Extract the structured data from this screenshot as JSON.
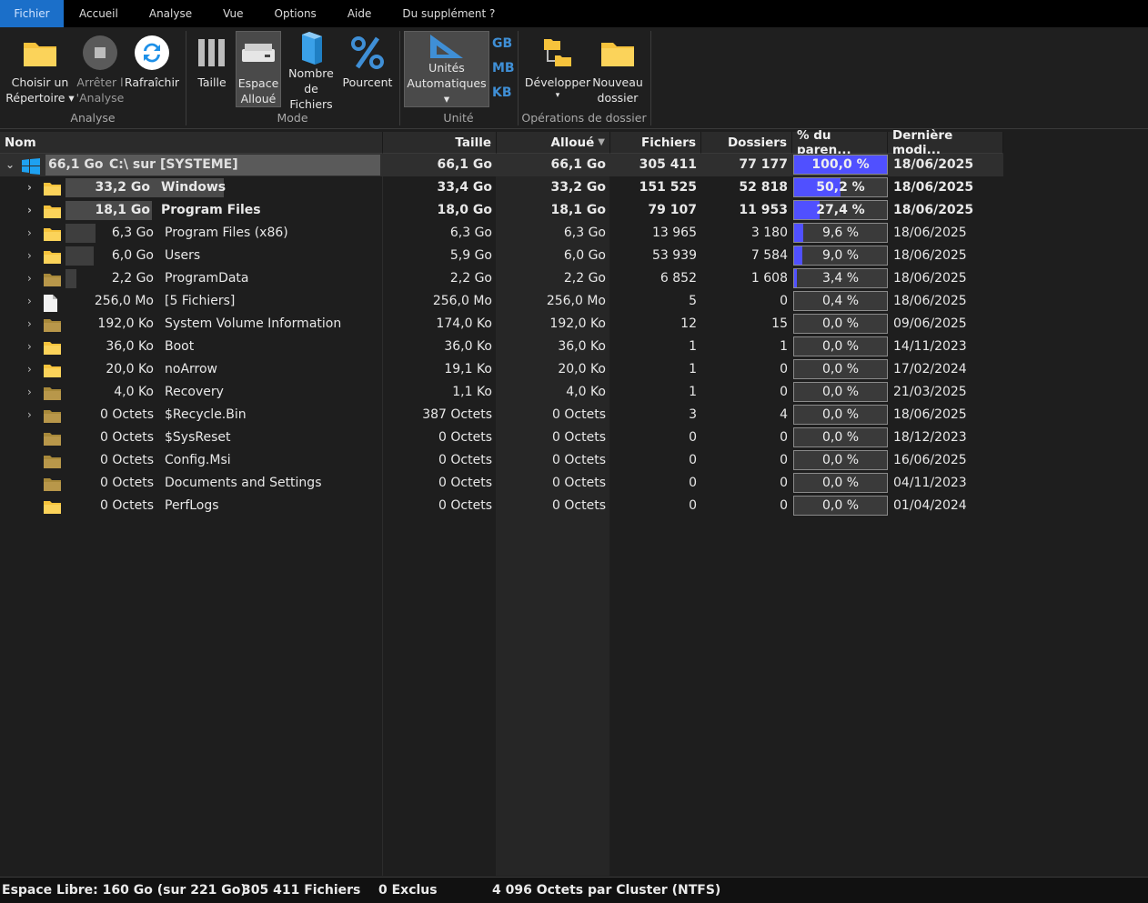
{
  "menu": [
    "Fichier",
    "Accueil",
    "Analyse",
    "Vue",
    "Options",
    "Aide",
    "Du supplément ?"
  ],
  "ribbon": {
    "choose_dir": [
      "Choisir un",
      "Répertoire ▾"
    ],
    "stop": [
      "Arrêter l",
      "'Analyse"
    ],
    "refresh": [
      "Rafraîchir"
    ],
    "size": [
      "Taille"
    ],
    "allocated": [
      "Espace",
      "Alloué"
    ],
    "file_count": [
      "Nombre",
      "de Fichiers"
    ],
    "percent": [
      "Pourcent"
    ],
    "units_auto": [
      "Unités",
      "Automatiques ▾"
    ],
    "unit_gb": "GB",
    "unit_mb": "MB",
    "unit_kb": "KB",
    "expand": [
      "Développer",
      "▾"
    ],
    "new_folder": [
      "Nouveau",
      "dossier"
    ],
    "groups": {
      "analyse": "Analyse",
      "mode": "Mode",
      "unit": "Unité",
      "folder_ops": "Opérations de dossier"
    }
  },
  "columns": {
    "name": "Nom",
    "size": "Taille",
    "allocated": "Alloué",
    "files": "Fichiers",
    "folders": "Dossiers",
    "pct": "% du paren...",
    "modified": "Dernière modi..."
  },
  "rows": [
    {
      "exp": "⌄",
      "icon": "windows",
      "alloc": "66,1 Go",
      "name": "C:\\  sur  [SYSTEME]",
      "size": "66,1 Go",
      "allocated": "66,1 Go",
      "files": "305 411",
      "folders": "77 177",
      "pct": 100.0,
      "pct_text": "100,0 %",
      "date": "18/06/2025",
      "bold": true,
      "root": true
    },
    {
      "exp": "›",
      "icon": "folder",
      "alloc": "33,2 Go",
      "name": "Windows",
      "size": "33,4 Go",
      "allocated": "33,2 Go",
      "files": "151 525",
      "folders": "52 818",
      "pct": 50.2,
      "pct_text": "50,2 %",
      "date": "18/06/2025",
      "bold": true,
      "bar": 0.5
    },
    {
      "exp": "›",
      "icon": "folder",
      "alloc": "18,1 Go",
      "name": "Program Files",
      "size": "18,0 Go",
      "allocated": "18,1 Go",
      "files": "79 107",
      "folders": "11 953",
      "pct": 27.4,
      "pct_text": "27,4 %",
      "date": "18/06/2025",
      "bold": true,
      "bar": 0.274
    },
    {
      "exp": "›",
      "icon": "folder",
      "alloc": "6,3 Go",
      "name": "Program Files (x86)",
      "size": "6,3 Go",
      "allocated": "6,3 Go",
      "files": "13 965",
      "folders": "3 180",
      "pct": 9.6,
      "pct_text": "9,6 %",
      "date": "18/06/2025",
      "bold": false,
      "bar": 0.096
    },
    {
      "exp": "›",
      "icon": "folder",
      "alloc": "6,0 Go",
      "name": "Users",
      "size": "5,9 Go",
      "allocated": "6,0 Go",
      "files": "53 939",
      "folders": "7 584",
      "pct": 9.0,
      "pct_text": "9,0 %",
      "date": "18/06/2025",
      "bold": false,
      "bar": 0.09
    },
    {
      "exp": "›",
      "icon": "folder-dim",
      "alloc": "2,2 Go",
      "name": "ProgramData",
      "size": "2,2 Go",
      "allocated": "2,2 Go",
      "files": "6 852",
      "folders": "1 608",
      "pct": 3.4,
      "pct_text": "3,4 %",
      "date": "18/06/2025",
      "bold": false,
      "bar": 0.034
    },
    {
      "exp": "›",
      "icon": "file",
      "alloc": "256,0 Mo",
      "name": "[5 Fichiers]",
      "size": "256,0 Mo",
      "allocated": "256,0 Mo",
      "files": "5",
      "folders": "0",
      "pct": 0.4,
      "pct_text": "0,4 %",
      "date": "18/06/2025",
      "bold": false,
      "bar": 0
    },
    {
      "exp": "›",
      "icon": "folder-dim",
      "alloc": "192,0 Ko",
      "name": "System Volume Information",
      "size": "174,0 Ko",
      "allocated": "192,0 Ko",
      "files": "12",
      "folders": "15",
      "pct": 0.0,
      "pct_text": "0,0 %",
      "date": "09/06/2025",
      "bold": false,
      "bar": 0
    },
    {
      "exp": "›",
      "icon": "folder",
      "alloc": "36,0 Ko",
      "name": "Boot",
      "size": "36,0 Ko",
      "allocated": "36,0 Ko",
      "files": "1",
      "folders": "1",
      "pct": 0.0,
      "pct_text": "0,0 %",
      "date": "14/11/2023",
      "bold": false,
      "bar": 0
    },
    {
      "exp": "›",
      "icon": "folder",
      "alloc": "20,0 Ko",
      "name": "noArrow",
      "size": "19,1 Ko",
      "allocated": "20,0 Ko",
      "files": "1",
      "folders": "0",
      "pct": 0.0,
      "pct_text": "0,0 %",
      "date": "17/02/2024",
      "bold": false,
      "bar": 0
    },
    {
      "exp": "›",
      "icon": "folder-dim",
      "alloc": "4,0 Ko",
      "name": "Recovery",
      "size": "1,1 Ko",
      "allocated": "4,0 Ko",
      "files": "1",
      "folders": "0",
      "pct": 0.0,
      "pct_text": "0,0 %",
      "date": "21/03/2025",
      "bold": false,
      "bar": 0
    },
    {
      "exp": "›",
      "icon": "folder-dim",
      "alloc": "0 Octets",
      "name": "$Recycle.Bin",
      "size": "387 Octets",
      "allocated": "0 Octets",
      "files": "3",
      "folders": "4",
      "pct": 0.0,
      "pct_text": "0,0 %",
      "date": "18/06/2025",
      "bold": false,
      "bar": 0
    },
    {
      "exp": "",
      "icon": "folder-dim",
      "alloc": "0 Octets",
      "name": "$SysReset",
      "size": "0 Octets",
      "allocated": "0 Octets",
      "files": "0",
      "folders": "0",
      "pct": 0.0,
      "pct_text": "0,0 %",
      "date": "18/12/2023",
      "bold": false,
      "bar": 0
    },
    {
      "exp": "",
      "icon": "folder-dim",
      "alloc": "0 Octets",
      "name": "Config.Msi",
      "size": "0 Octets",
      "allocated": "0 Octets",
      "files": "0",
      "folders": "0",
      "pct": 0.0,
      "pct_text": "0,0 %",
      "date": "16/06/2025",
      "bold": false,
      "bar": 0
    },
    {
      "exp": "",
      "icon": "folder-dim",
      "alloc": "0 Octets",
      "name": "Documents and Settings",
      "size": "0 Octets",
      "allocated": "0 Octets",
      "files": "0",
      "folders": "0",
      "pct": 0.0,
      "pct_text": "0,0 %",
      "date": "04/11/2023",
      "bold": false,
      "bar": 0
    },
    {
      "exp": "",
      "icon": "folder",
      "alloc": "0 Octets",
      "name": "PerfLogs",
      "size": "0 Octets",
      "allocated": "0 Octets",
      "files": "0",
      "folders": "0",
      "pct": 0.0,
      "pct_text": "0,0 %",
      "date": "01/04/2024",
      "bold": false,
      "bar": 0
    }
  ],
  "status": {
    "free": "Espace Libre: 160 Go  (sur 221 Go)",
    "files": "305 411 Fichiers",
    "excluded": "0 Exclus",
    "cluster": "4 096 Octets par Cluster (NTFS)"
  },
  "colors": {
    "accent": "#1b6fc9",
    "pct_bar": "#5050ff",
    "folder": "#f6c33c"
  }
}
